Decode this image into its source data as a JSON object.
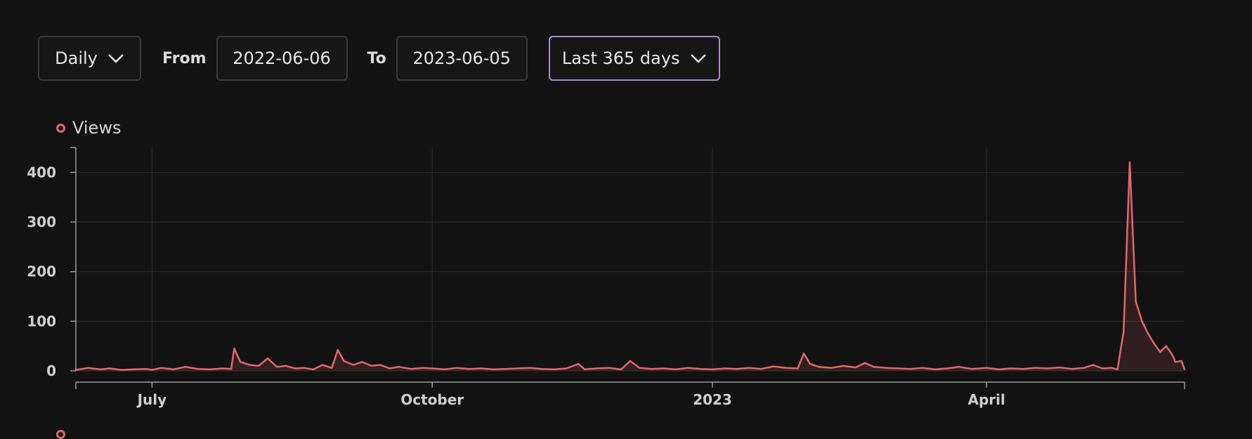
{
  "toolbar": {
    "interval": "Daily",
    "from_label": "From",
    "from_value": "2022-06-06",
    "to_label": "To",
    "to_value": "2023-06-05",
    "range": "Last 365 days"
  },
  "legend": {
    "series": "Views",
    "color": "#e2686a"
  },
  "chart_data": {
    "type": "area",
    "x_start": "2022-06-06",
    "x_end": "2023-06-05",
    "ylim": [
      0,
      450
    ],
    "yticks": [
      0,
      100,
      200,
      300,
      400
    ],
    "xticks": [
      {
        "date": "2022-07-01",
        "label": "July"
      },
      {
        "date": "2022-10-01",
        "label": "October"
      },
      {
        "date": "2023-01-01",
        "label": "2023"
      },
      {
        "date": "2023-04-01",
        "label": "April"
      }
    ],
    "grid": true,
    "series": [
      {
        "name": "Views",
        "color": "#e2686a",
        "points": [
          [
            "2022-06-06",
            2
          ],
          [
            "2022-06-10",
            6
          ],
          [
            "2022-06-14",
            3
          ],
          [
            "2022-06-17",
            5
          ],
          [
            "2022-06-21",
            2
          ],
          [
            "2022-06-25",
            3
          ],
          [
            "2022-06-29",
            4
          ],
          [
            "2022-07-01",
            2
          ],
          [
            "2022-07-04",
            6
          ],
          [
            "2022-07-08",
            3
          ],
          [
            "2022-07-12",
            8
          ],
          [
            "2022-07-16",
            4
          ],
          [
            "2022-07-20",
            3
          ],
          [
            "2022-07-24",
            5
          ],
          [
            "2022-07-27",
            4
          ],
          [
            "2022-07-28",
            45
          ],
          [
            "2022-07-30",
            18
          ],
          [
            "2022-08-02",
            12
          ],
          [
            "2022-08-05",
            10
          ],
          [
            "2022-08-08",
            25
          ],
          [
            "2022-08-11",
            8
          ],
          [
            "2022-08-14",
            10
          ],
          [
            "2022-08-17",
            5
          ],
          [
            "2022-08-20",
            6
          ],
          [
            "2022-08-23",
            3
          ],
          [
            "2022-08-26",
            12
          ],
          [
            "2022-08-29",
            6
          ],
          [
            "2022-08-31",
            42
          ],
          [
            "2022-09-02",
            20
          ],
          [
            "2022-09-05",
            12
          ],
          [
            "2022-09-08",
            18
          ],
          [
            "2022-09-11",
            10
          ],
          [
            "2022-09-14",
            12
          ],
          [
            "2022-09-17",
            5
          ],
          [
            "2022-09-20",
            8
          ],
          [
            "2022-09-24",
            4
          ],
          [
            "2022-09-28",
            6
          ],
          [
            "2022-10-01",
            5
          ],
          [
            "2022-10-05",
            3
          ],
          [
            "2022-10-09",
            6
          ],
          [
            "2022-10-13",
            4
          ],
          [
            "2022-10-17",
            5
          ],
          [
            "2022-10-21",
            3
          ],
          [
            "2022-10-25",
            4
          ],
          [
            "2022-10-29",
            5
          ],
          [
            "2022-11-02",
            6
          ],
          [
            "2022-11-06",
            4
          ],
          [
            "2022-11-10",
            3
          ],
          [
            "2022-11-14",
            5
          ],
          [
            "2022-11-18",
            14
          ],
          [
            "2022-11-20",
            3
          ],
          [
            "2022-11-24",
            5
          ],
          [
            "2022-11-28",
            6
          ],
          [
            "2022-12-02",
            3
          ],
          [
            "2022-12-05",
            20
          ],
          [
            "2022-12-08",
            6
          ],
          [
            "2022-12-12",
            4
          ],
          [
            "2022-12-16",
            5
          ],
          [
            "2022-12-20",
            3
          ],
          [
            "2022-12-24",
            6
          ],
          [
            "2022-12-28",
            4
          ],
          [
            "2023-01-01",
            3
          ],
          [
            "2023-01-05",
            5
          ],
          [
            "2023-01-09",
            4
          ],
          [
            "2023-01-13",
            6
          ],
          [
            "2023-01-17",
            4
          ],
          [
            "2023-01-21",
            9
          ],
          [
            "2023-01-25",
            6
          ],
          [
            "2023-01-29",
            5
          ],
          [
            "2023-01-31",
            35
          ],
          [
            "2023-02-02",
            14
          ],
          [
            "2023-02-05",
            8
          ],
          [
            "2023-02-09",
            6
          ],
          [
            "2023-02-13",
            10
          ],
          [
            "2023-02-17",
            7
          ],
          [
            "2023-02-20",
            16
          ],
          [
            "2023-02-23",
            8
          ],
          [
            "2023-02-27",
            6
          ],
          [
            "2023-03-03",
            5
          ],
          [
            "2023-03-07",
            4
          ],
          [
            "2023-03-11",
            6
          ],
          [
            "2023-03-15",
            3
          ],
          [
            "2023-03-19",
            5
          ],
          [
            "2023-03-23",
            8
          ],
          [
            "2023-03-27",
            4
          ],
          [
            "2023-04-01",
            6
          ],
          [
            "2023-04-05",
            3
          ],
          [
            "2023-04-09",
            5
          ],
          [
            "2023-04-13",
            4
          ],
          [
            "2023-04-17",
            6
          ],
          [
            "2023-04-21",
            5
          ],
          [
            "2023-04-25",
            7
          ],
          [
            "2023-04-29",
            4
          ],
          [
            "2023-05-03",
            6
          ],
          [
            "2023-05-06",
            12
          ],
          [
            "2023-05-09",
            5
          ],
          [
            "2023-05-12",
            6
          ],
          [
            "2023-05-14",
            3
          ],
          [
            "2023-05-16",
            80
          ],
          [
            "2023-05-18",
            420
          ],
          [
            "2023-05-20",
            140
          ],
          [
            "2023-05-22",
            100
          ],
          [
            "2023-05-24",
            75
          ],
          [
            "2023-05-26",
            55
          ],
          [
            "2023-05-28",
            38
          ],
          [
            "2023-05-30",
            50
          ],
          [
            "2023-06-01",
            32
          ],
          [
            "2023-06-02",
            18
          ],
          [
            "2023-06-04",
            20
          ],
          [
            "2023-06-05",
            3
          ]
        ]
      }
    ]
  }
}
